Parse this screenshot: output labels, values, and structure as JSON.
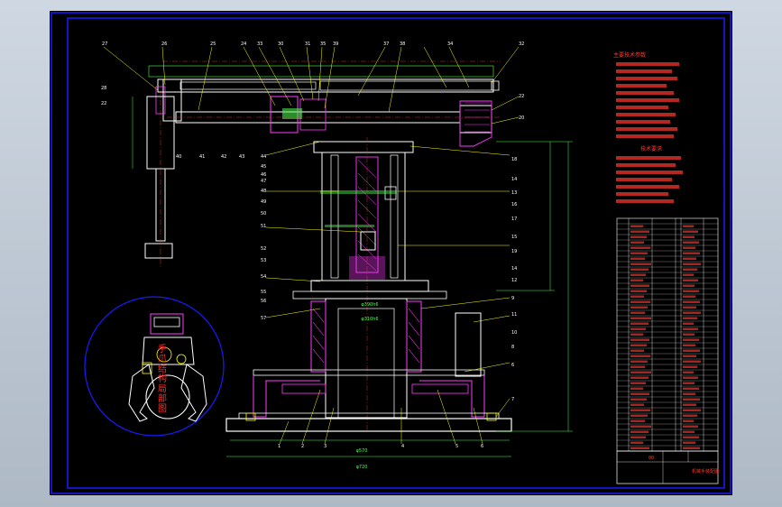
{
  "drawing": {
    "inset_label": "手爪结构局部图",
    "tech_heading": "主要技术参数",
    "tech_heading2": "技术要求",
    "balloons_top": [
      "27",
      "26",
      "25",
      "24",
      "33",
      "30",
      "31",
      "35",
      "39",
      "37",
      "38",
      "34",
      "32"
    ],
    "balloons_left": [
      "28",
      "22",
      "40",
      "41",
      "42",
      "43",
      "44",
      "45",
      "46",
      "47",
      "48",
      "49",
      "50",
      "51",
      "52",
      "53",
      "54",
      "55",
      "56",
      "57"
    ],
    "balloons_right": [
      "22",
      "20",
      "18",
      "14",
      "13",
      "16",
      "17",
      "15",
      "19",
      "14",
      "12",
      "9",
      "11",
      "10",
      "8",
      "6",
      "7"
    ],
    "balloons_bottom": [
      "1",
      "2",
      "3",
      "4",
      "5",
      "6"
    ],
    "bottom_dimension_1": "φ570",
    "bottom_dimension_2": "φ720",
    "inner_dimension_1": "φ390h6",
    "inner_dimension_2": "φ310h6",
    "title_block_mark": "00",
    "title_block_name": "机械手装配图"
  },
  "colors": {
    "background": "#000000",
    "frame": "#1a1aff",
    "outline": "#ffffff",
    "hatch": "#ff3bff",
    "dimension": "#4dff4d",
    "centerline": "#ff3b30",
    "accent_yellow": "#ffff00",
    "annotation_red": "#ff2a2a"
  }
}
